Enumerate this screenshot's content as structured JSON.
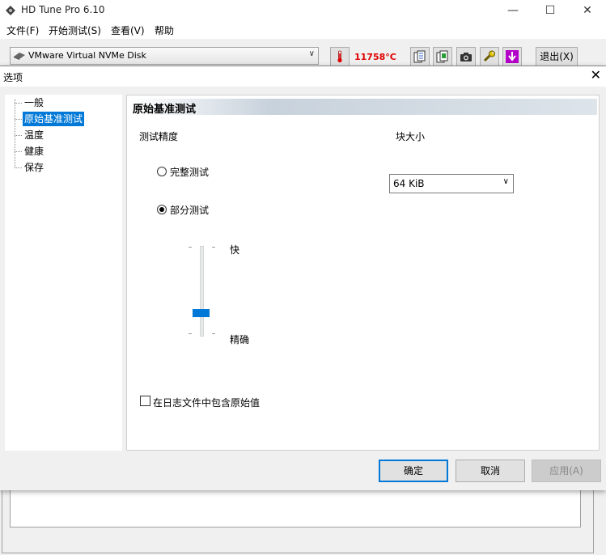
{
  "main_window": {
    "title": "HD Tune Pro 6.10",
    "controls": {
      "minimize": "—",
      "maximize": "☐",
      "close": "✕"
    },
    "menu": [
      {
        "label": "文件(F)"
      },
      {
        "label": "开始测试(S)"
      },
      {
        "label": "查看(V)"
      },
      {
        "label": "帮助"
      }
    ],
    "toolbar": {
      "disk": "VMware Virtual NVMe Disk",
      "temperature": "11758°C",
      "exit_label": "退出(X)"
    }
  },
  "dialog": {
    "title": "选项",
    "close_glyph": "✕",
    "nav": [
      {
        "label": "一般",
        "selected": false
      },
      {
        "label": "原始基准测试",
        "selected": true
      },
      {
        "label": "温度",
        "selected": false
      },
      {
        "label": "健康",
        "selected": false
      },
      {
        "label": "保存",
        "selected": false
      }
    ],
    "section_title": "原始基准测试",
    "accuracy_label": "测试精度",
    "block_size_label": "块大小",
    "radio_full": "完整测试",
    "radio_partial": "部分测试",
    "selected_mode": "部分测试",
    "block_size_value": "64 KiB",
    "slider_top_label": "快",
    "slider_bottom_label": "精确",
    "slider_level": 0.25,
    "include_raw_label": "在日志文件中包含原始值",
    "include_raw_checked": false,
    "buttons": {
      "ok": "确定",
      "cancel": "取消",
      "apply": "应用(A)"
    }
  },
  "colors": {
    "accent": "#0078d7",
    "temperature": "#e00000"
  }
}
